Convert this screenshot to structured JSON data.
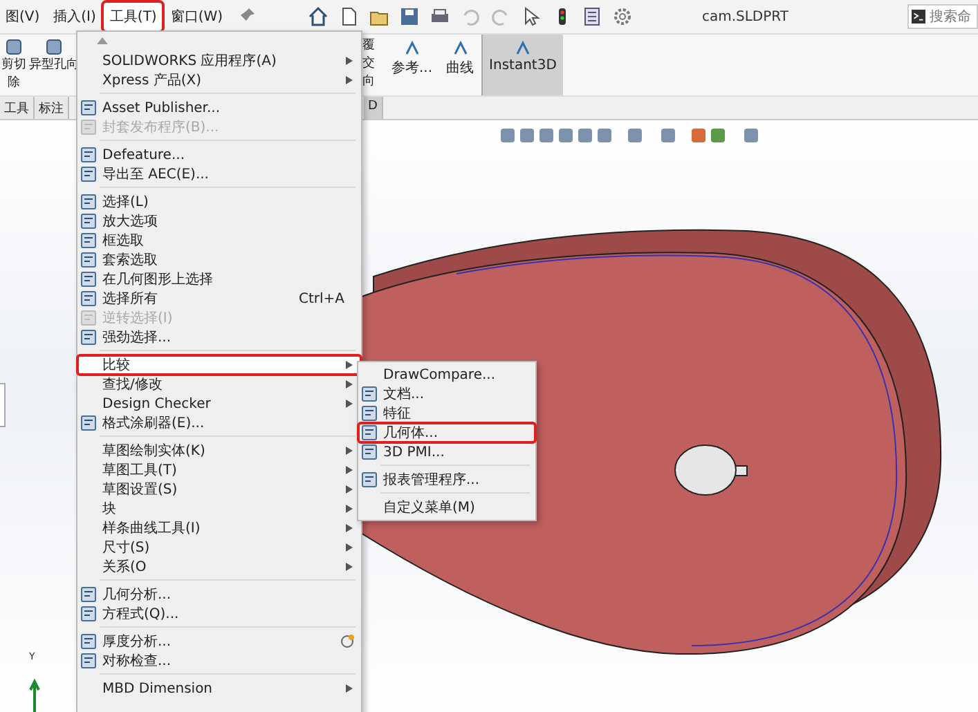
{
  "menubar": {
    "items": [
      {
        "label": "图(V)",
        "selected": false,
        "annotated": false
      },
      {
        "label": "插入(I)",
        "selected": false,
        "annotated": false
      },
      {
        "label": "工具(T)",
        "selected": true,
        "annotated": true
      },
      {
        "label": "窗口(W)",
        "selected": false,
        "annotated": false
      }
    ]
  },
  "window": {
    "title": "cam.SLDPRT"
  },
  "search": {
    "placeholder": "搜索命"
  },
  "ribbon": {
    "left": [
      {
        "lines": [
          "剪切",
          "除"
        ]
      },
      {
        "lines": [
          "异型孔向"
        ]
      }
    ],
    "right_cut": [
      "覆",
      "交",
      "向"
    ],
    "right": [
      {
        "label": "参考...",
        "pressed": false
      },
      {
        "label": "曲线",
        "pressed": false
      },
      {
        "label": "Instant3D",
        "pressed": true
      }
    ]
  },
  "tabs": [
    {
      "label": "工具",
      "selected": false
    },
    {
      "label": "标注",
      "selected": false
    },
    {
      "label": "D",
      "selected": true
    }
  ],
  "menu": {
    "sections": [
      [
        {
          "label": "SOLIDWORKS 应用程序(A)",
          "has_icon": false,
          "disabled": false,
          "submenu": true,
          "selected": false,
          "annotated": false
        },
        {
          "label": "Xpress 产品(X)",
          "has_icon": false,
          "disabled": false,
          "submenu": true,
          "selected": false,
          "annotated": false
        }
      ],
      [
        {
          "label": "Asset Publisher...",
          "has_icon": true,
          "disabled": false,
          "submenu": false,
          "selected": false,
          "annotated": false
        },
        {
          "label": "封套发布程序(B)...",
          "has_icon": true,
          "disabled": true,
          "submenu": false,
          "selected": false,
          "annotated": false
        }
      ],
      [
        {
          "label": "Defeature...",
          "has_icon": true,
          "disabled": false,
          "submenu": false,
          "selected": false,
          "annotated": false
        },
        {
          "label": "导出至 AEC(E)...",
          "has_icon": true,
          "disabled": false,
          "submenu": false,
          "selected": false,
          "annotated": false
        }
      ],
      [
        {
          "label": "选择(L)",
          "has_icon": true,
          "disabled": false,
          "submenu": false,
          "selected": false,
          "annotated": false
        },
        {
          "label": "放大选项",
          "has_icon": true,
          "disabled": false,
          "submenu": false,
          "selected": false,
          "annotated": false
        },
        {
          "label": "框选取",
          "has_icon": true,
          "disabled": false,
          "submenu": false,
          "selected": false,
          "annotated": false
        },
        {
          "label": "套索选取",
          "has_icon": true,
          "disabled": false,
          "submenu": false,
          "selected": false,
          "annotated": false
        },
        {
          "label": "在几何图形上选择",
          "has_icon": true,
          "disabled": false,
          "submenu": false,
          "selected": false,
          "annotated": false
        },
        {
          "label": "选择所有",
          "shortcut": "Ctrl+A",
          "has_icon": true,
          "disabled": false,
          "submenu": false,
          "selected": false,
          "annotated": false
        },
        {
          "label": "逆转选择(I)",
          "has_icon": true,
          "disabled": true,
          "submenu": false,
          "selected": false,
          "annotated": false
        },
        {
          "label": "强劲选择...",
          "has_icon": true,
          "disabled": false,
          "submenu": false,
          "selected": false,
          "annotated": false
        }
      ],
      [
        {
          "label": "比较",
          "has_icon": false,
          "disabled": false,
          "submenu": true,
          "selected": true,
          "annotated": true
        },
        {
          "label": "查找/修改",
          "has_icon": false,
          "disabled": false,
          "submenu": true,
          "selected": false,
          "annotated": false
        },
        {
          "label": "Design Checker",
          "has_icon": false,
          "disabled": false,
          "submenu": true,
          "selected": false,
          "annotated": false
        },
        {
          "label": "格式涂刷器(E)...",
          "has_icon": true,
          "disabled": false,
          "submenu": false,
          "selected": false,
          "annotated": false
        }
      ],
      [
        {
          "label": "草图绘制实体(K)",
          "has_icon": false,
          "disabled": false,
          "submenu": true,
          "selected": false,
          "annotated": false
        },
        {
          "label": "草图工具(T)",
          "has_icon": false,
          "disabled": false,
          "submenu": true,
          "selected": false,
          "annotated": false
        },
        {
          "label": "草图设置(S)",
          "has_icon": false,
          "disabled": false,
          "submenu": true,
          "selected": false,
          "annotated": false
        },
        {
          "label": "块",
          "has_icon": false,
          "disabled": false,
          "submenu": true,
          "selected": false,
          "annotated": false
        },
        {
          "label": "样条曲线工具(I)",
          "has_icon": false,
          "disabled": false,
          "submenu": true,
          "selected": false,
          "annotated": false
        },
        {
          "label": "尺寸(S)",
          "has_icon": false,
          "disabled": false,
          "submenu": true,
          "selected": false,
          "annotated": false
        },
        {
          "label": "关系(O",
          "has_icon": false,
          "disabled": false,
          "submenu": true,
          "selected": false,
          "annotated": false
        }
      ],
      [
        {
          "label": "几何分析...",
          "has_icon": true,
          "disabled": false,
          "submenu": false,
          "selected": false,
          "annotated": false
        },
        {
          "label": "方程式(Q)...",
          "has_icon": true,
          "disabled": false,
          "submenu": false,
          "selected": false,
          "annotated": false
        }
      ],
      [
        {
          "label": "厚度分析...",
          "has_icon": true,
          "disabled": false,
          "submenu": false,
          "selected": false,
          "annotated": false,
          "help_badge": true
        },
        {
          "label": "对称检查...",
          "has_icon": true,
          "disabled": false,
          "submenu": false,
          "selected": false,
          "annotated": false
        }
      ],
      [
        {
          "label": "MBD Dimension",
          "has_icon": false,
          "disabled": false,
          "submenu": true,
          "selected": false,
          "annotated": false
        }
      ]
    ]
  },
  "submenu": {
    "sections": [
      [
        {
          "label": "DrawCompare...",
          "has_icon": false,
          "annotated": false
        },
        {
          "label": "文档...",
          "has_icon": true,
          "annotated": false
        },
        {
          "label": "特征",
          "has_icon": true,
          "annotated": false
        },
        {
          "label": "几何体...",
          "has_icon": true,
          "annotated": true
        },
        {
          "label": "3D PMI...",
          "has_icon": true,
          "annotated": false
        }
      ],
      [
        {
          "label": "报表管理程序...",
          "has_icon": true,
          "annotated": false
        }
      ],
      [
        {
          "label": "自定义菜单(M)",
          "has_icon": false,
          "annotated": false
        }
      ]
    ]
  },
  "triad": {
    "axis_label": "Y"
  }
}
